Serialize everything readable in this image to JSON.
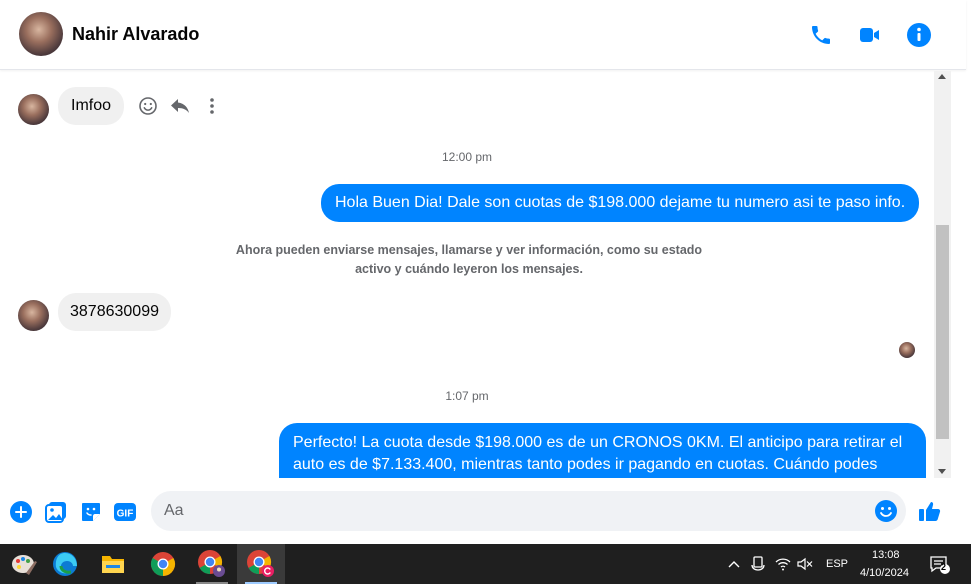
{
  "header": {
    "contact_name": "Nahir Alvarado",
    "icons": [
      "phone-icon",
      "video-camera-icon",
      "info-icon"
    ]
  },
  "thread": {
    "messages": [
      {
        "direction": "in",
        "text": "Imfoo"
      },
      {
        "type": "timestamp",
        "text": "12:00 pm"
      },
      {
        "direction": "out",
        "text": "Hola Buen Dia! Dale son cuotas de $198.000 dejame tu numero asi te paso info."
      },
      {
        "type": "notice",
        "line1": "Ahora pueden enviarse mensajes, llamarse y ver información, como su estado",
        "line2": "activo y cuándo leyeron los mensajes."
      },
      {
        "direction": "in",
        "text": "3878630099"
      },
      {
        "type": "timestamp",
        "text": "1:07 pm"
      },
      {
        "direction": "out",
        "line1": "Perfecto! La cuota desde $198.000 es de un CRONOS 0KM. El anticipo para retirar el",
        "line2": "auto es de $7.133.400, mientras tanto podes ir pagando en cuotas. Cuándo podes"
      }
    ],
    "message_action_icons": [
      "smiley-icon",
      "reply-icon",
      "more-icon"
    ]
  },
  "composer": {
    "placeholder": "Aa",
    "icons": [
      "plus-circle-icon",
      "image-icon",
      "sticker-icon",
      "gif-icon",
      "emoji-icon",
      "thumbs-up-icon"
    ],
    "gif_label": "GIF"
  },
  "colors": {
    "accent": "#0084ff",
    "incoming_bubble": "#f0f0f0",
    "secondary_text": "#65676b",
    "taskbar": "#1f1f1f"
  },
  "taskbar": {
    "apps": [
      "paint-icon",
      "edge-icon",
      "file-explorer-icon",
      "chrome-icon",
      "chrome-profile-icon",
      "chrome-profile-c-icon"
    ],
    "language": "ESP",
    "time": "13:08",
    "date": "4/10/2024",
    "notification_count": "2"
  }
}
